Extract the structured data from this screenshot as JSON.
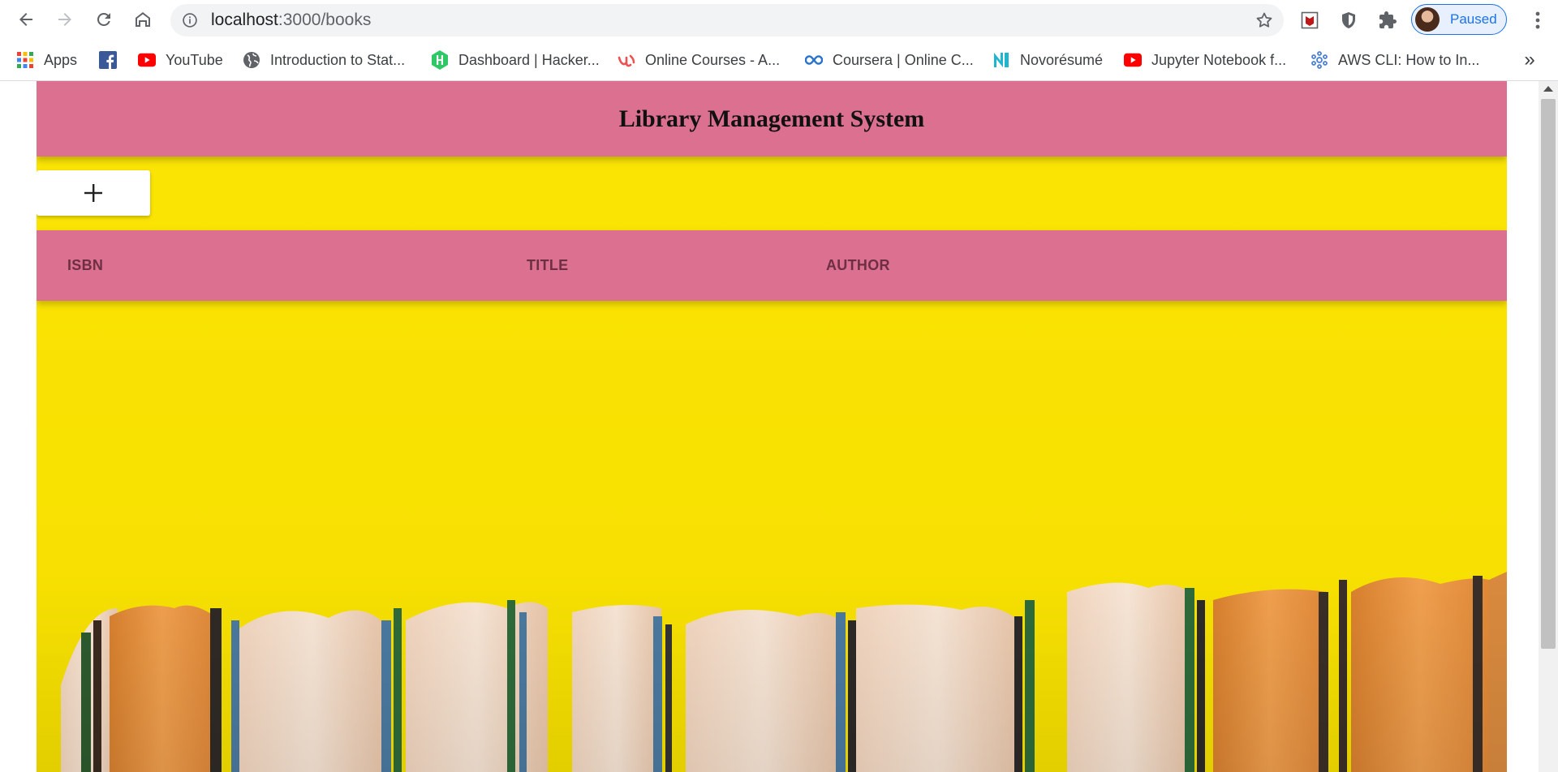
{
  "browser": {
    "url_host": "localhost",
    "url_path": ":3000/books",
    "profile_label": "Paused",
    "bookmarks": [
      {
        "label": "Apps",
        "icon": "apps-grid-icon"
      },
      {
        "label": "",
        "icon": "facebook-icon"
      },
      {
        "label": "YouTube",
        "icon": "youtube-icon"
      },
      {
        "label": "Introduction to Stat...",
        "icon": "globe-icon"
      },
      {
        "label": "Dashboard | Hacker...",
        "icon": "hackerrank-icon"
      },
      {
        "label": "Online Courses - A...",
        "icon": "udemy-icon"
      },
      {
        "label": "Coursera | Online C...",
        "icon": "coursera-icon"
      },
      {
        "label": "Novorésumé",
        "icon": "novoresume-icon"
      },
      {
        "label": "Jupyter Notebook f...",
        "icon": "youtube-icon"
      },
      {
        "label": "AWS CLI: How to In...",
        "icon": "aws-icon"
      }
    ],
    "more_label": "»"
  },
  "page": {
    "title": "Library Management System",
    "add_label": "+",
    "columns": [
      "ISBN",
      "TITLE",
      "AUTHOR"
    ]
  },
  "colors": {
    "header": "#db7091",
    "background": "#fbe400",
    "accent": "#1a73e8"
  }
}
